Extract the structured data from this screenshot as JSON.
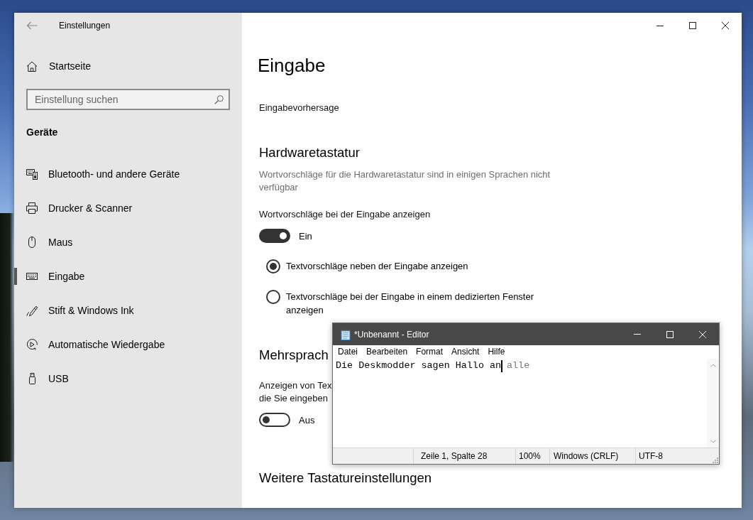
{
  "settings_window": {
    "title": "Einstellungen",
    "sidebar": {
      "home": "Startseite",
      "search": {
        "placeholder": "Einstellung suchen"
      },
      "section": "Geräte",
      "items": [
        {
          "label": "Bluetooth- und andere Geräte",
          "selected": false
        },
        {
          "label": "Drucker & Scanner",
          "selected": false
        },
        {
          "label": "Maus",
          "selected": false
        },
        {
          "label": "Eingabe",
          "selected": true
        },
        {
          "label": "Stift & Windows Ink",
          "selected": false
        },
        {
          "label": "Automatische Wiedergabe",
          "selected": false
        },
        {
          "label": "USB",
          "selected": false
        }
      ]
    },
    "page": {
      "title": "Eingabe",
      "sections": [
        {
          "items": [
            {
              "kind": "label",
              "text": "Eingabevorhersage"
            }
          ]
        },
        {
          "heading": "Hardwaretastatur",
          "items": [
            {
              "kind": "note",
              "text": "Wortvorschläge für die Hardwaretastatur sind in einigen Sprachen nicht verfügbar"
            },
            {
              "kind": "label",
              "text": "Wortvorschläge bei der Eingabe anzeigen"
            },
            {
              "kind": "toggle",
              "on": true,
              "state_text": "Ein"
            },
            {
              "kind": "radio",
              "text": "Textvorschläge neben der Eingabe anzeigen",
              "selected": true
            },
            {
              "kind": "radio",
              "text": "Textvorschläge bei der Eingabe in einem dedizierten Fenster anzeigen",
              "selected": false
            }
          ]
        },
        {
          "heading": "Mehrsprach",
          "items": [
            {
              "kind": "label",
              "text": "Anzeigen von Tex\ndie Sie eingeben"
            },
            {
              "kind": "toggle",
              "on": false,
              "state_text": "Aus"
            }
          ]
        },
        {
          "heading": "Weitere Tastatureinstellungen"
        }
      ]
    }
  },
  "notepad": {
    "title": "*Unbenannt - Editor",
    "menu": [
      "Datei",
      "Bearbeiten",
      "Format",
      "Ansicht",
      "Hilfe"
    ],
    "editor": {
      "value": "Die Deskmodder sagen Hallo an",
      "suggestion": "alle"
    },
    "status_bar": {
      "position": "Zeile 1, Spalte 28",
      "zoom": "100%",
      "line_endings": "Windows (CRLF)",
      "encoding": "UTF-8"
    }
  }
}
